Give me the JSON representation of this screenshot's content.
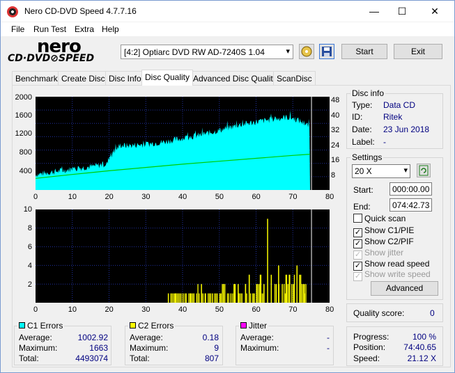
{
  "window": {
    "title": "Nero CD-DVD Speed 4.7.7.16",
    "min": "—",
    "max": "☐",
    "close": "✕"
  },
  "menu": {
    "file": "File",
    "run_test": "Run Test",
    "extra": "Extra",
    "help": "Help"
  },
  "logo": {
    "line1": "nero",
    "line2": "CD·DVD⊘SPEED"
  },
  "toolbar": {
    "drive": "[4:2]  Optiarc DVD RW AD-7240S 1.04",
    "start": "Start",
    "exit": "Exit"
  },
  "tabs": [
    "Benchmark",
    "Create Disc",
    "Disc Info",
    "Disc Quality",
    "Advanced Disc Quality",
    "ScanDisc"
  ],
  "chart_data": [
    {
      "type": "area",
      "title": "",
      "y_left_ticks": [
        "2000",
        "1600",
        "1200",
        "800",
        "400"
      ],
      "y_right_ticks": [
        "48",
        "40",
        "32",
        "24",
        "16",
        "8"
      ],
      "x_ticks": [
        "0",
        "10",
        "20",
        "30",
        "40",
        "50",
        "60",
        "70",
        "80"
      ],
      "xlim": [
        0,
        80
      ],
      "ylim": [
        0,
        2000
      ],
      "y2lim": [
        0,
        48
      ],
      "series": [
        {
          "name": "C1",
          "color": "#00ffff",
          "x": [
            0,
            5,
            10,
            15,
            19.5,
            20,
            23,
            25,
            30,
            35,
            40,
            45,
            50,
            55,
            60,
            65,
            68,
            70,
            72,
            74.7
          ],
          "y": [
            330,
            390,
            450,
            500,
            560,
            700,
            960,
            950,
            980,
            1030,
            1110,
            1180,
            1280,
            1390,
            1460,
            1520,
            1560,
            1540,
            1480,
            1350
          ]
        },
        {
          "name": "read speed",
          "color": "#00cc00",
          "x": [
            0,
            10,
            20,
            30,
            40,
            50,
            60,
            70,
            74.7
          ],
          "y": [
            6.0,
            8.0,
            9.9,
            11.6,
            13.3,
            14.8,
            16.3,
            17.8,
            18.4
          ]
        }
      ]
    },
    {
      "type": "bar",
      "title": "",
      "y_ticks": [
        "10",
        "8",
        "6",
        "4",
        "2"
      ],
      "x_ticks": [
        "0",
        "10",
        "20",
        "30",
        "40",
        "50",
        "60",
        "70",
        "80"
      ],
      "xlim": [
        0,
        80
      ],
      "ylim": [
        0,
        10
      ],
      "series": [
        {
          "name": "C2",
          "color": "#ffff00",
          "x": [
            36,
            38,
            40,
            42,
            45,
            46,
            48,
            50,
            51,
            53,
            54,
            55,
            56,
            57,
            58,
            59,
            60,
            61,
            62,
            63,
            64,
            65,
            66,
            67,
            68,
            69,
            70,
            71,
            72,
            73
          ],
          "y": [
            1,
            1,
            1,
            1,
            2,
            1,
            1,
            1,
            2,
            1,
            2,
            2,
            1,
            2,
            3,
            1,
            2,
            3,
            2,
            9,
            3,
            2,
            4,
            2,
            3,
            3,
            2,
            4,
            3,
            2
          ]
        }
      ]
    }
  ],
  "disc_info": {
    "title": "Disc info",
    "type_l": "Type:",
    "type_v": "Data CD",
    "id_l": "ID:",
    "id_v": "Ritek",
    "date_l": "Date:",
    "date_v": "23 Jun 2018",
    "label_l": "Label:",
    "label_v": "-"
  },
  "settings": {
    "title": "Settings",
    "speed": "20 X",
    "start_l": "Start:",
    "start_v": "000:00.00",
    "end_l": "End:",
    "end_v": "074:42.73",
    "quick_scan": "Quick scan",
    "show_c1": "Show C1/PIE",
    "show_c2": "Show C2/PIF",
    "show_jitter": "Show jitter",
    "show_read": "Show read speed",
    "show_write": "Show write speed",
    "advanced": "Advanced"
  },
  "quality": {
    "label": "Quality score:",
    "value": "0"
  },
  "progress": {
    "progress_l": "Progress:",
    "progress_v": "100 %",
    "position_l": "Position:",
    "position_v": "74:40.65",
    "speed_l": "Speed:",
    "speed_v": "21.12 X"
  },
  "c1": {
    "title": "C1 Errors",
    "color": "#00ffff",
    "avg_l": "Average:",
    "avg_v": "1002.92",
    "max_l": "Maximum:",
    "max_v": "1663",
    "tot_l": "Total:",
    "tot_v": "4493074"
  },
  "c2": {
    "title": "C2 Errors",
    "color": "#ffff00",
    "avg_l": "Average:",
    "avg_v": "0.18",
    "max_l": "Maximum:",
    "max_v": "9",
    "tot_l": "Total:",
    "tot_v": "807"
  },
  "jitter": {
    "title": "Jitter",
    "color": "#ff00ff",
    "avg_l": "Average:",
    "avg_v": "-",
    "max_l": "Maximum:",
    "max_v": "-"
  }
}
